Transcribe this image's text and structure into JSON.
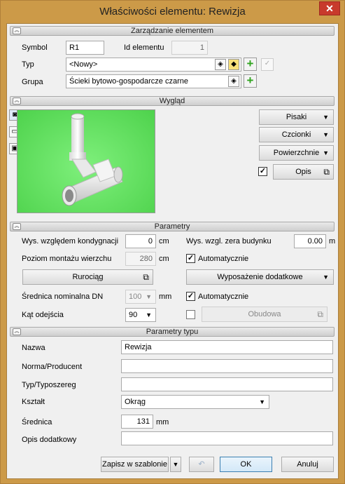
{
  "window": {
    "title": "Właściwości elementu: Rewizja",
    "close": "✕"
  },
  "sections": {
    "management": "Zarządzanie elementem",
    "appearance": "Wygląd",
    "parameters": "Parametry",
    "type_params": "Parametry typu"
  },
  "management": {
    "symbol_label": "Symbol",
    "symbol_value": "R1",
    "id_label": "Id elementu",
    "id_value": "1",
    "typ_label": "Typ",
    "typ_value": "<Nowy>",
    "grupa_label": "Grupa",
    "grupa_value": "Ścieki bytowo-gospodarcze czarne"
  },
  "appearance": {
    "pisaki": "Pisaki",
    "czcionki": "Czcionki",
    "powierzchnie": "Powierzchnie",
    "opis": "Opis",
    "opis_checked": true
  },
  "parameters": {
    "wys_kond_label": "Wys. względem kondygnacji",
    "wys_kond_value": "0",
    "wys_kond_unit": "cm",
    "wys_zera_label": "Wys. wzgl. zera budynku",
    "wys_zera_value": "0.00",
    "wys_zera_unit": "m",
    "poziom_label": "Poziom montażu wierzchu",
    "poziom_value": "280",
    "poziom_unit": "cm",
    "auto1_label": "Automatycznie",
    "auto1_checked": true,
    "rurociag": "Rurociąg",
    "wyposazenie": "Wyposażenie dodatkowe",
    "srednica_dn_label": "Średnica nominalna DN",
    "srednica_dn_value": "100",
    "srednica_dn_unit": "mm",
    "auto2_label": "Automatycznie",
    "auto2_checked": true,
    "kat_label": "Kąt odejścia",
    "kat_value": "90",
    "obudowa": "Obudowa",
    "obudowa_checked": false
  },
  "type_params": {
    "nazwa_label": "Nazwa",
    "nazwa_value": "Rewizja",
    "norma_label": "Norma/Producent",
    "norma_value": "",
    "typoszereg_label": "Typ/Typoszereg",
    "typoszereg_value": "",
    "ksztalt_label": "Kształt",
    "ksztalt_value": "Okrąg",
    "srednica_label": "Średnica",
    "srednica_value": "131",
    "srednica_unit": "mm",
    "opis_dod_label": "Opis dodatkowy",
    "opis_dod_value": ""
  },
  "footer": {
    "zapisz": "Zapisz w szablonie",
    "ok": "OK",
    "anuluj": "Anuluj"
  },
  "colors": {
    "frame": "#cc9a48",
    "close": "#c83a2c",
    "preview_bg": "#5ee05b",
    "plus": "#2fa41e"
  },
  "icons": [
    "close-icon",
    "chevron-up-icon",
    "pipe-preview-image",
    "camera-icon",
    "folder-icon",
    "cube-icon",
    "add-icon",
    "check-icon",
    "color-icon",
    "undo-icon",
    "dropdown-arrow-icon",
    "open-dialog-icon"
  ]
}
